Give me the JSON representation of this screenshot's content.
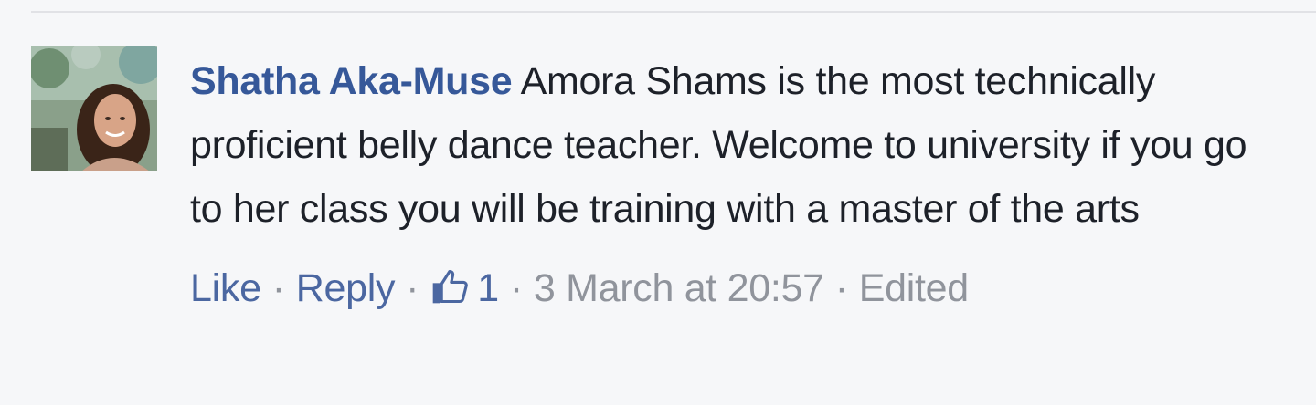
{
  "comment": {
    "avatar_icon": "profile-photo",
    "author": "Shatha Aka-Muse",
    "text": "Amora Shams is the most technically proficient belly dance teacher. Welcome to university if you go to her class you will be training with a master of the arts",
    "actions": {
      "like_label": "Like",
      "reply_label": "Reply",
      "like_icon": "thumbs-up-icon",
      "like_count": "1",
      "timestamp": "3 March at 20:57",
      "edited_label": "Edited",
      "separator": "·"
    }
  },
  "colors": {
    "background": "#f6f7f9",
    "author_link": "#365899",
    "action_link": "#4b67a1",
    "body_text": "#1d2129",
    "meta_text": "#90949c"
  }
}
